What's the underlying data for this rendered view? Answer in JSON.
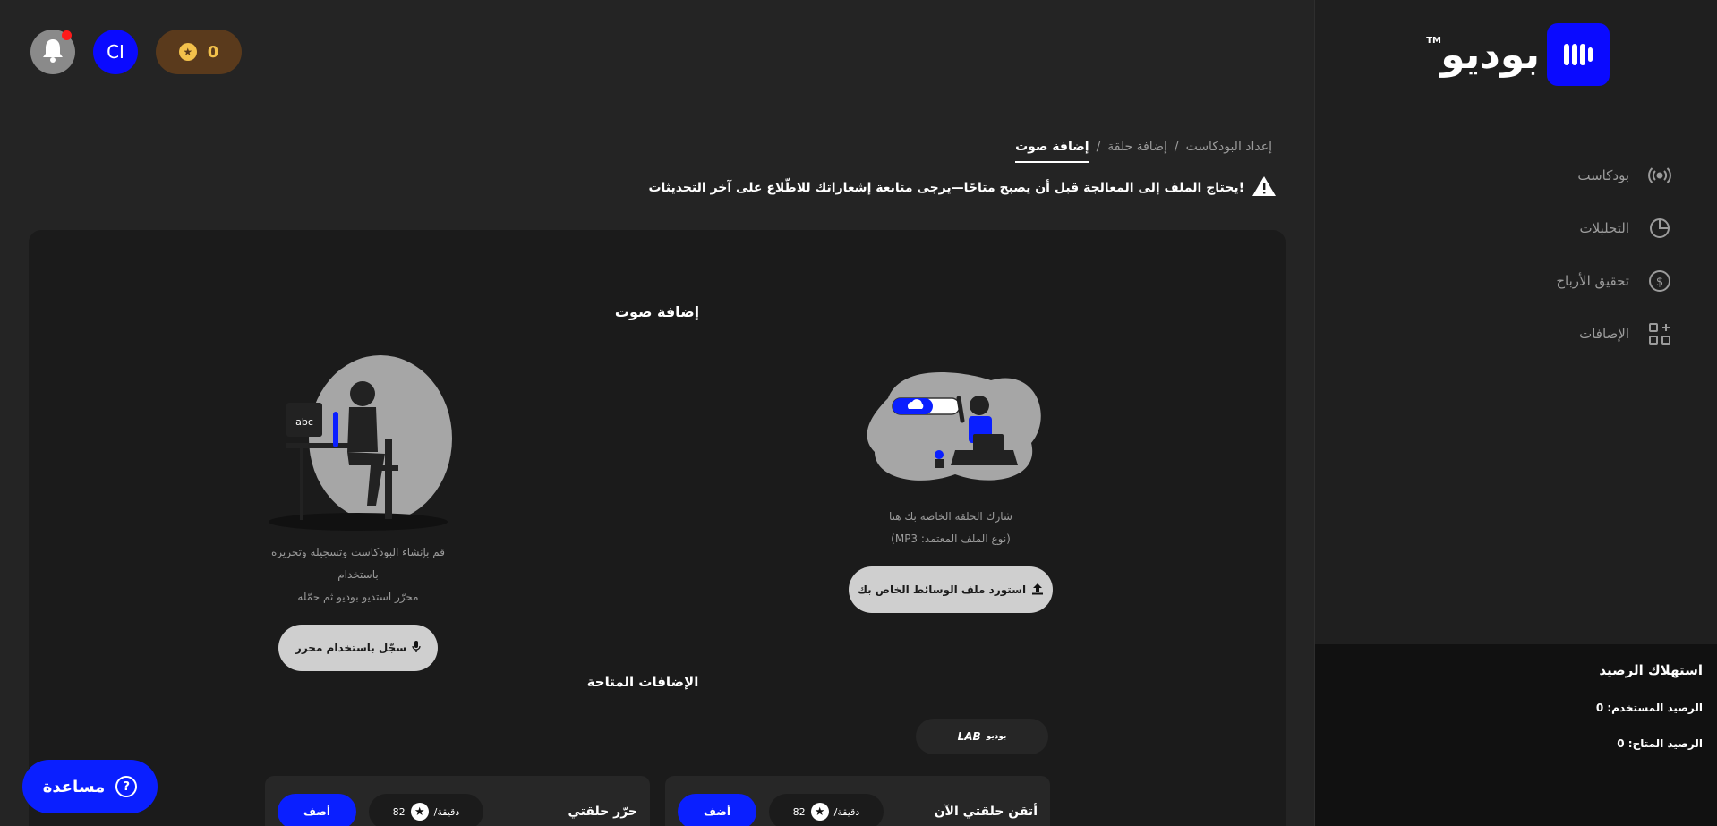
{
  "brand": {
    "name": "بوديو",
    "tm": "TM"
  },
  "sidebar": {
    "items": [
      {
        "label": "بودكاست",
        "icon": "podcast-icon"
      },
      {
        "label": "التحليلات",
        "icon": "analytics-icon"
      },
      {
        "label": "تحقيق الأرباح",
        "icon": "dollar-icon"
      },
      {
        "label": "الإضافات",
        "icon": "addons-icon"
      }
    ]
  },
  "balance": {
    "title": "استهلاك الرصيد",
    "used_label": "الرصيد المستخدم: 0",
    "available_label": "الرصيد المتاح: 0"
  },
  "topbar": {
    "avatar_initials": "CI",
    "coins": "0"
  },
  "breadcrumb": {
    "items": [
      "إعداد البودكاست",
      "إضافة حلقة",
      "إضافة صوت"
    ],
    "separator": "/"
  },
  "warning": "!يحتاج الملف إلى المعالجة قبل أن يصبح متاحًا—يرجى متابعة إشعاراتك للاطّلاع على آخر التحديثات",
  "card": {
    "title": "إضافة صوت",
    "upload": {
      "desc_line1": "شارك الحلقة الخاصة بك هنا",
      "desc_line2": "(نوع الملف المعتمد: MP3)",
      "button": "استورد ملف الوسائط الخاص بك"
    },
    "record": {
      "desc_line1": "قم بإنشاء البودكاست وتسجيله وتحريره باستخدام",
      "desc_line2": "محرّر استديو بوديو ثم حمّله",
      "button": "سجّل باستخدام محرر"
    },
    "addons_title": "الإضافات المتاحة",
    "lab_tag": {
      "lab": "LAB",
      "brand": "بوديو"
    },
    "addons": [
      {
        "name": "أتقن حلقتي الآن",
        "price": "82",
        "unit": "دقيقة/",
        "add": "أضف"
      },
      {
        "name": "حرّر حلقتي",
        "price": "82",
        "unit": "دقيقة/",
        "add": "أضف"
      }
    ]
  },
  "help": "مساعدة",
  "colors": {
    "accent": "#0a1fff",
    "background": "#242424",
    "coin": "#f3c14b"
  }
}
